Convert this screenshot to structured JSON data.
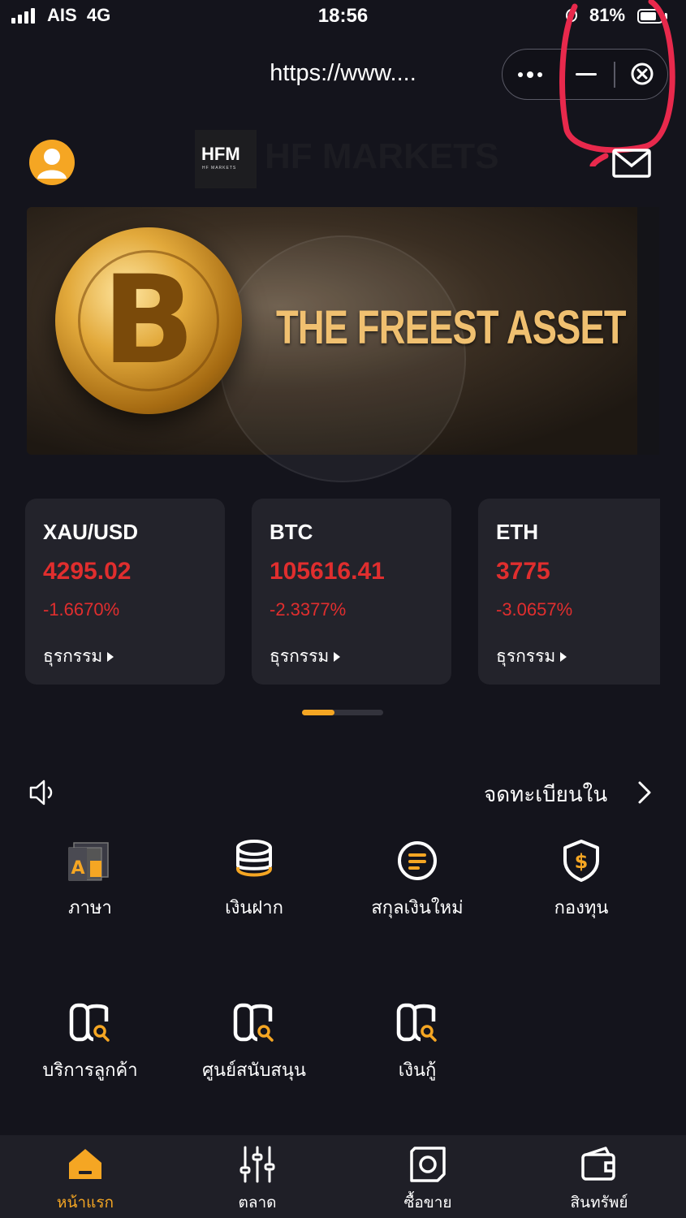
{
  "status_bar": {
    "carrier": "AIS",
    "network": "4G",
    "time": "18:56",
    "battery": "81%",
    "battery_level": 0.81
  },
  "browser": {
    "url": "https://www....",
    "more_icon": "more-dots-icon",
    "minimize_icon": "minimize-icon",
    "close_icon": "close-circle-icon"
  },
  "header": {
    "logo_text": "HFM",
    "logo_subtext": "HF MARKETS",
    "logo_ghost_text": "HF MARKETS",
    "avatar_icon": "user-icon",
    "mail_icon": "mail-icon"
  },
  "banner": {
    "title": "THE FREEST ASSET"
  },
  "tickers": [
    {
      "symbol": "XAU/USD",
      "price": "4295.02",
      "change": "-1.6670%",
      "action": "ธุรกรรม"
    },
    {
      "symbol": "BTC",
      "price": "105616.41",
      "change": "-2.3377%",
      "action": "ธุรกรรม"
    },
    {
      "symbol": "ETH",
      "price": "3775",
      "change": "-3.0657%",
      "action": "ธุรกรรม"
    }
  ],
  "notice": {
    "text": "จดทะเบียนใน"
  },
  "shortcuts": [
    {
      "label": "ภาษา",
      "icon": "language-icon"
    },
    {
      "label": "เงินฝาก",
      "icon": "deposit-coins-icon"
    },
    {
      "label": "สกุลเงินใหม่",
      "icon": "new-currency-icon"
    },
    {
      "label": "กองทุน",
      "icon": "fund-shield-icon"
    },
    {
      "label": "บริการลูกค้า",
      "icon": "customer-service-icon"
    },
    {
      "label": "ศูนย์สนับสนุน",
      "icon": "support-center-icon"
    },
    {
      "label": "เงินกู้",
      "icon": "loan-icon"
    }
  ],
  "bottom_nav": [
    {
      "label": "หน้าแรก",
      "icon": "home-icon",
      "active": true
    },
    {
      "label": "ตลาด",
      "icon": "market-sliders-icon",
      "active": false
    },
    {
      "label": "ซื้อขาย",
      "icon": "trade-icon",
      "active": false
    },
    {
      "label": "สินทรัพย์",
      "icon": "wallet-icon",
      "active": false
    }
  ],
  "colors": {
    "background": "#14141c",
    "card": "#23232b",
    "accent": "#f5a623",
    "negative": "#e02e2e",
    "annotation": "#e8294c"
  }
}
